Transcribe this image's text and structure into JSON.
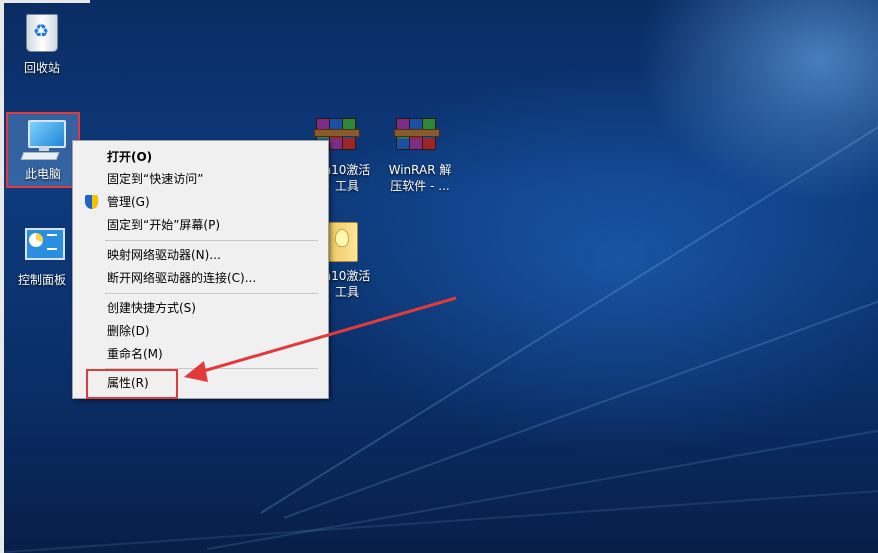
{
  "desktop": {
    "icons": {
      "recycle_bin": "回收站",
      "this_pc": "此电脑",
      "control_panel": "控制面板",
      "win10_activate_1": "n10激活\n工具",
      "winrar": "WinRAR 解\n压软件 - ...",
      "win10_activate_2": "n10激活\n工具"
    }
  },
  "context_menu": {
    "items": [
      {
        "label": "打开(O)",
        "bold": true
      },
      {
        "label": "固定到“快速访问”"
      },
      {
        "label": "管理(G)",
        "icon": "uac-shield-icon"
      },
      {
        "label": "固定到“开始”屏幕(P)"
      },
      {
        "label": "映射网络驱动器(N)..."
      },
      {
        "label": "断开网络驱动器的连接(C)..."
      },
      {
        "label": "创建快捷方式(S)"
      },
      {
        "label": "删除(D)"
      },
      {
        "label": "重命名(M)"
      },
      {
        "label": "属性(R)"
      }
    ]
  },
  "annotations": {
    "highlight_color": "#e23a3a",
    "arrow_color": "#e23a3a"
  }
}
